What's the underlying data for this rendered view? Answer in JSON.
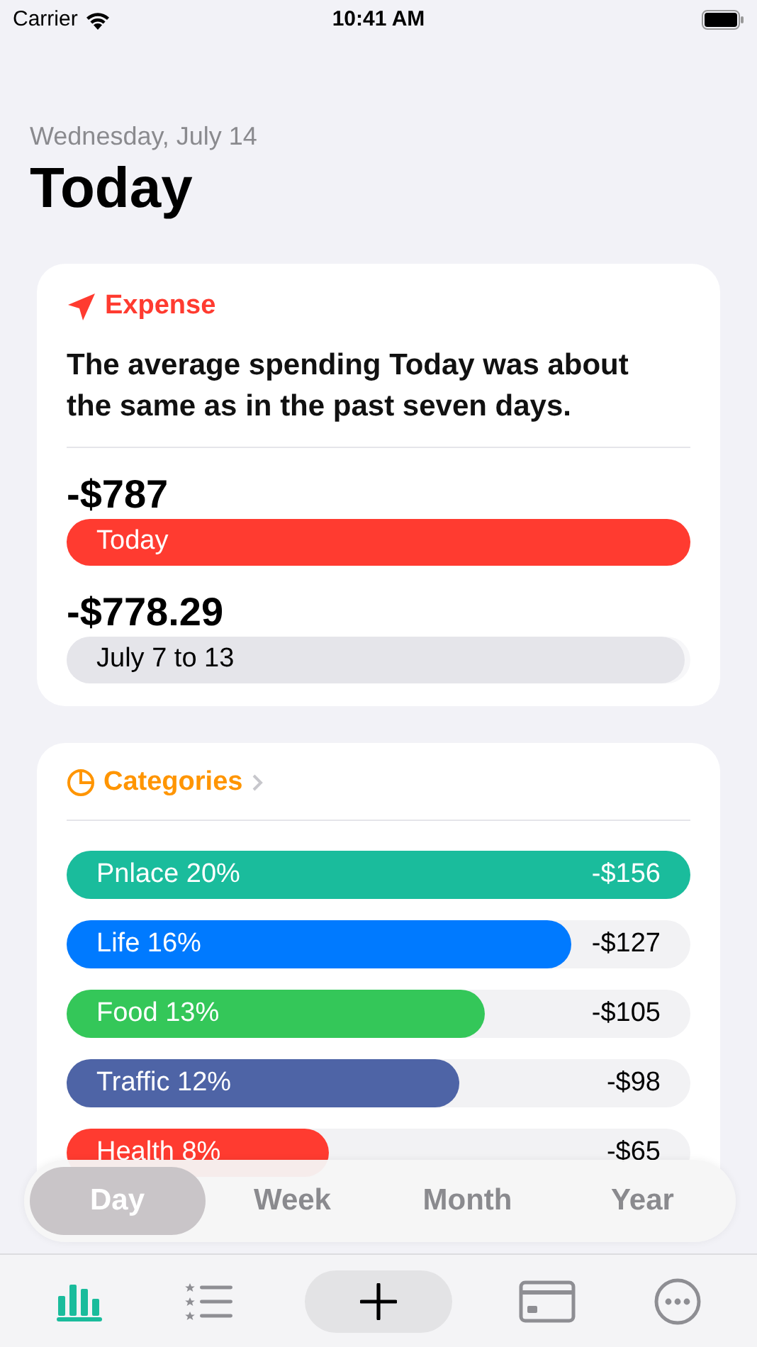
{
  "status_bar": {
    "carrier": "Carrier",
    "time": "10:41 AM"
  },
  "header": {
    "date": "Wednesday, July 14",
    "title": "Today"
  },
  "expense_card": {
    "title": "Expense",
    "summary": "The average spending Today was about the same as in the past seven days.",
    "comparisons": [
      {
        "amount": "-$787",
        "label": "Today",
        "level": 1,
        "color": "#ff3b30"
      },
      {
        "amount": "-$778.29",
        "label": "July 7 to 13",
        "level": 0.99,
        "color": "#e5e5ea"
      }
    ]
  },
  "categories_card": {
    "title": "Categories",
    "items": [
      {
        "label": "Pnlace 20%",
        "amount": "-$156",
        "level": 1,
        "color": "#1abc9c"
      },
      {
        "label": "Life 16%",
        "amount": "-$127",
        "level": 0.81,
        "color": "#007aff"
      },
      {
        "label": "Food 13%",
        "amount": "-$105",
        "level": 0.67,
        "color": "#34c759"
      },
      {
        "label": "Traffic 12%",
        "amount": "-$98",
        "level": 0.63,
        "color": "#4e64a6"
      },
      {
        "label": "Health 8%",
        "amount": "-$65",
        "level": 0.42,
        "color": "#ff3b30"
      }
    ]
  },
  "period_tabs": [
    {
      "label": "Day",
      "selected": true
    },
    {
      "label": "Week",
      "selected": false
    },
    {
      "label": "Month",
      "selected": false
    },
    {
      "label": "Year",
      "selected": false
    }
  ],
  "tab_bar": [
    {
      "kind": "chart",
      "selected": true
    },
    {
      "kind": "list",
      "selected": false
    },
    {
      "kind": "add",
      "selected": false
    },
    {
      "kind": "card",
      "selected": false
    },
    {
      "kind": "more",
      "selected": false
    }
  ]
}
